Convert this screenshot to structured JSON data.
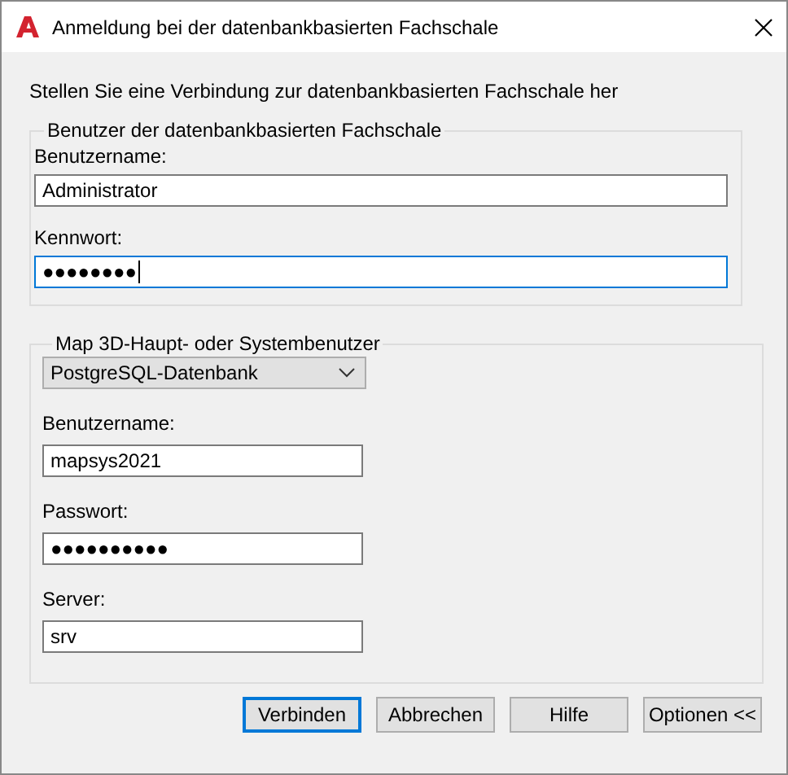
{
  "window": {
    "title": "Anmeldung bei der datenbankbasierten Fachschale"
  },
  "intro": "Stellen Sie eine Verbindung zur datenbankbasierten Fachschale her",
  "groups": [
    {
      "legend": "Benutzer der datenbankbasierten Fachschale",
      "wide": true,
      "items": [
        {
          "kind": "field",
          "label": "Benutzername:",
          "value": "Administrator",
          "focused": false
        },
        {
          "kind": "field",
          "label": "Kennwort:",
          "value": "●●●●●●●●",
          "focused": true
        }
      ]
    },
    {
      "legend": "Map 3D-Haupt- oder Systembenutzer",
      "wide": false,
      "items": [
        {
          "kind": "dropdown",
          "value": "PostgreSQL-Datenbank"
        },
        {
          "kind": "field",
          "label": "Benutzername:",
          "value": "mapsys2021",
          "focused": false
        },
        {
          "kind": "field",
          "label": "Passwort:",
          "value": "●●●●●●●●●●",
          "focused": false
        },
        {
          "kind": "field",
          "label": "Server:",
          "value": "srv",
          "focused": false
        }
      ]
    }
  ],
  "buttons": [
    {
      "label": "Verbinden",
      "default": true
    },
    {
      "label": "Abbrechen",
      "default": false
    },
    {
      "label": "Hilfe",
      "default": false
    },
    {
      "label": "Optionen <<",
      "default": false
    }
  ]
}
